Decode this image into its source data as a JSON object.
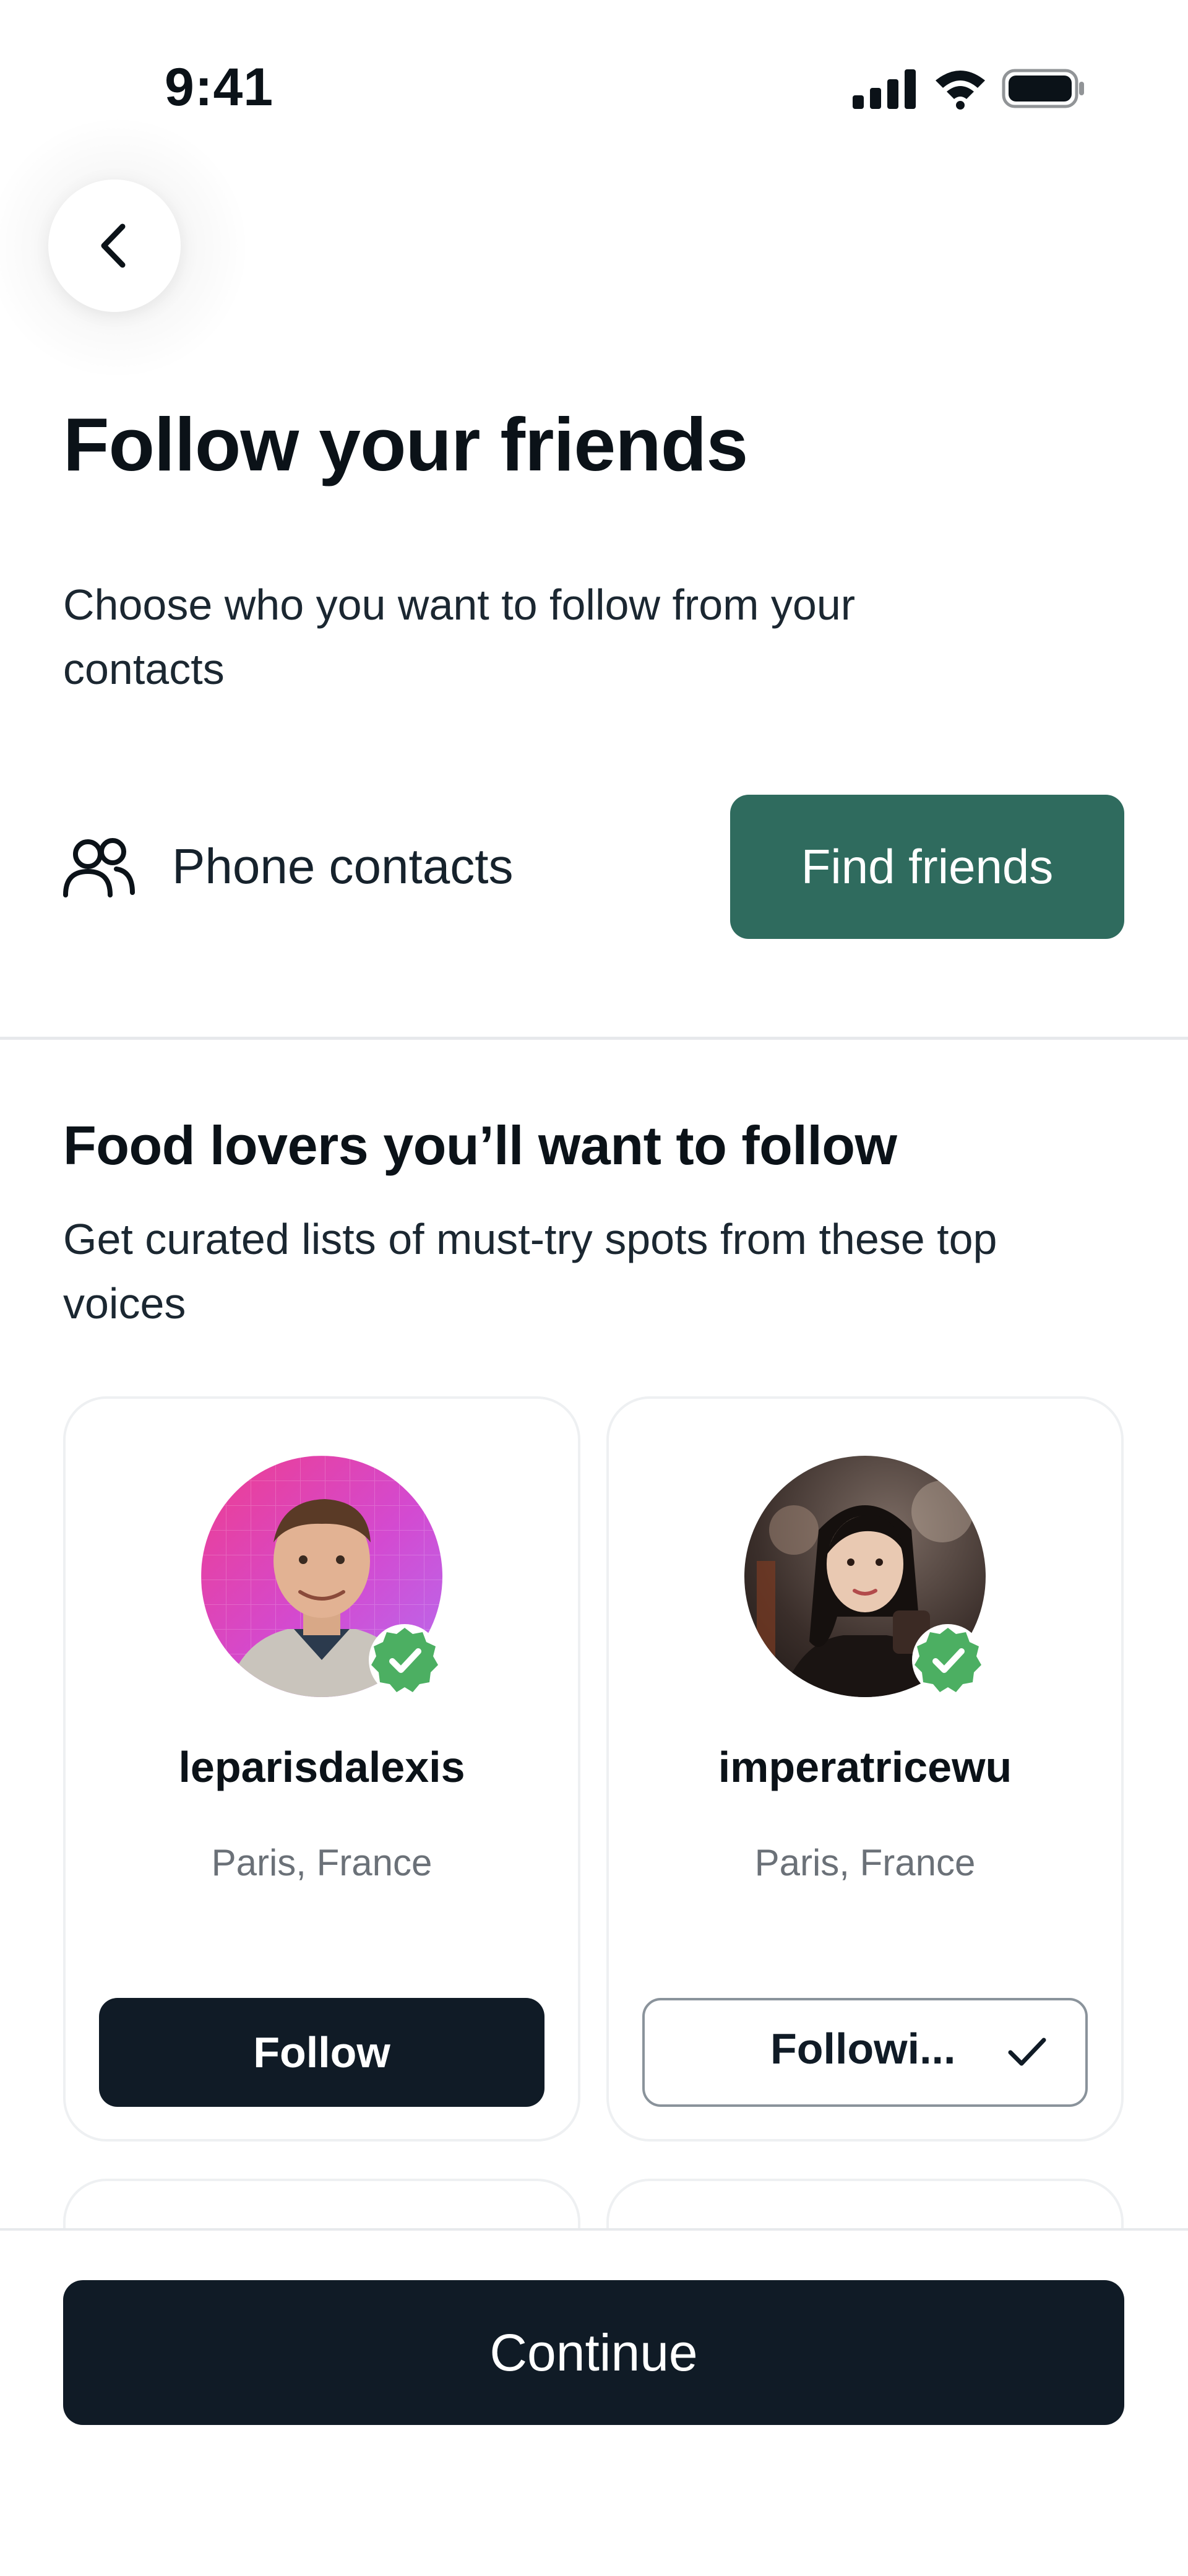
{
  "status_bar": {
    "time": "9:41",
    "icons": [
      "cellular-signal-icon",
      "wifi-icon",
      "battery-icon"
    ]
  },
  "header": {
    "back_icon": "chevron-left-icon",
    "title": "Follow your friends",
    "subtitle": "Choose who you want to follow from your contacts"
  },
  "contacts": {
    "icon": "people-icon",
    "label": "Phone contacts",
    "button_label": "Find friends"
  },
  "section": {
    "title": "Food lovers you’ll want to follow",
    "subtitle": "Get curated lists of must-try spots from these top voices"
  },
  "creators": [
    {
      "username": "leparisdalexis",
      "location": "Paris, France",
      "verified": true,
      "button_label": "Follow",
      "following": false
    },
    {
      "username": "imperatricewu",
      "location": "Paris, France",
      "verified": true,
      "button_label": "Followi...",
      "following": true
    }
  ],
  "footer": {
    "continue_label": "Continue"
  },
  "colors": {
    "primary_green": "#2f6b5e",
    "dark_navy": "#101b26",
    "verified_green": "#4caf62"
  }
}
